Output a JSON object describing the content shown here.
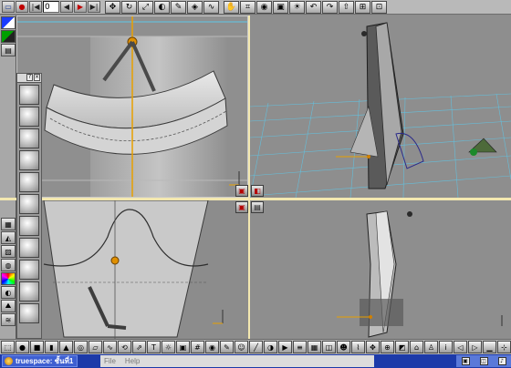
{
  "app": {
    "title": "truespace: ชั้นที่1",
    "menu": [
      "File",
      "Help"
    ]
  },
  "top_toolbar": {
    "frame_value": "0",
    "buttons": [
      "record",
      "rewind",
      "prev-frame",
      "play",
      "next-frame",
      "forward-to-end",
      "object-move",
      "object-rotate",
      "object-scale",
      "render",
      "paint",
      "animate",
      "paths",
      "grab-tool",
      "deform",
      "nav-eye",
      "camera",
      "light",
      "undo",
      "redo"
    ]
  },
  "viewports": {
    "front": {
      "label": "front-view"
    },
    "perspective": {
      "label": "perspective-view"
    },
    "side": {
      "label": "side-view"
    },
    "top": {
      "label": "top-view"
    }
  },
  "colors": {
    "grid": "#5ec7e8",
    "axis_y": "#e8a000",
    "gizmo": "#d08000",
    "divider": "#f3e8b0",
    "taskbar": "#1c3aa9",
    "accent_red": "#c00000"
  },
  "material_panel": {
    "swatches": 12
  },
  "object_toolbar": {
    "icons": [
      "select-icon",
      "sphere-icon",
      "cube-icon",
      "cylinder-icon",
      "cone-icon",
      "torus-icon",
      "plane-icon",
      "spline-icon",
      "lathe-icon",
      "sweep-icon",
      "text-icon",
      "light-icon",
      "camera-icon",
      "grid-icon",
      "material-icon",
      "paint-icon",
      "face-icon",
      "bone-icon",
      "shadow-icon",
      "render-icon"
    ]
  },
  "taskbar": {
    "app_button": "truespace: ชั้นที่1"
  }
}
